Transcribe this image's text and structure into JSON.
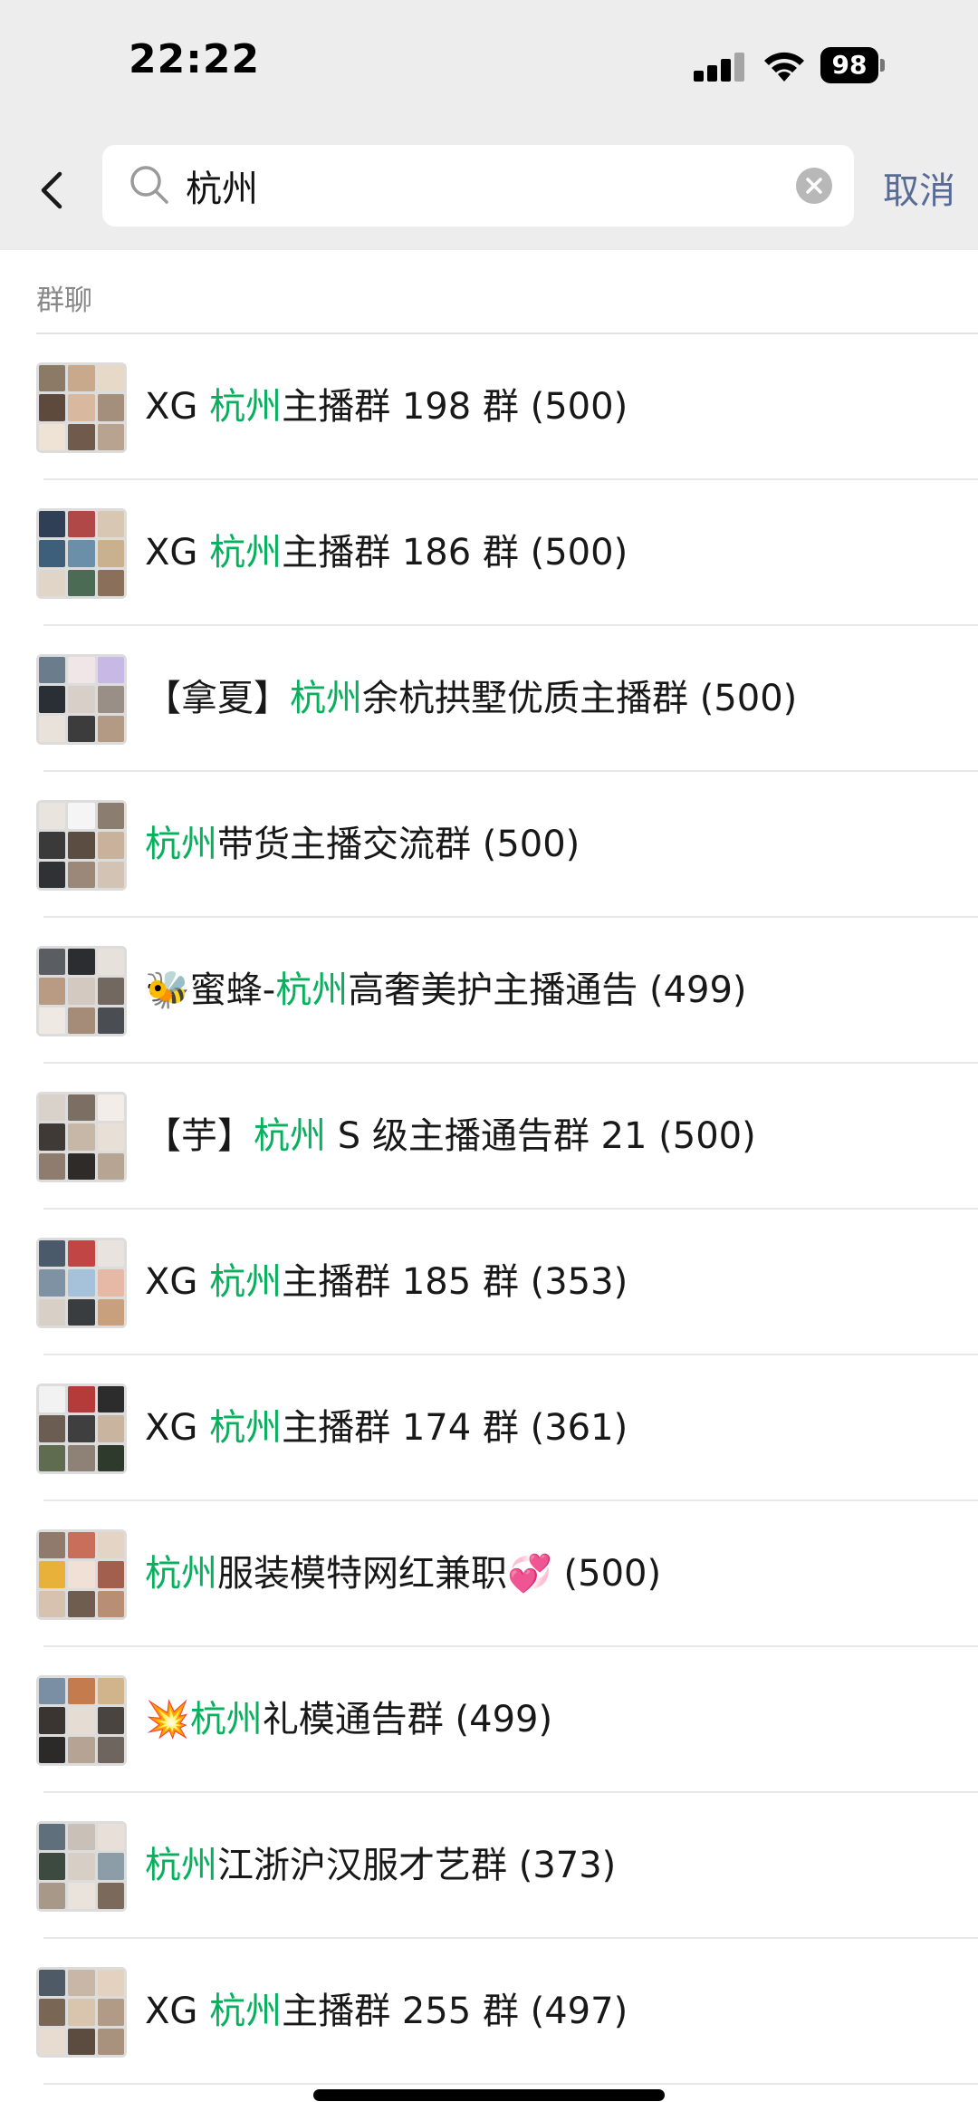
{
  "status_bar": {
    "time": "22:22",
    "battery_level": "98",
    "signal_icon": "cellular-signal-icon",
    "wifi_icon": "wifi-icon"
  },
  "search": {
    "query": "杭州",
    "placeholder": "",
    "cancel_label": "取消",
    "back_icon": "chevron-left-icon",
    "search_icon": "magnifier-icon",
    "clear_icon": "clear-circle-icon"
  },
  "section": {
    "title": "群聊"
  },
  "colors": {
    "keyword_highlight": "#07b05d",
    "link_blue": "#576b95",
    "header_background": "#ededed"
  },
  "results": [
    {
      "pre": "XG ",
      "kw": "杭州",
      "post": "主播群 198 群 (500)"
    },
    {
      "pre": "XG ",
      "kw": "杭州",
      "post": "主播群 186 群 (500)"
    },
    {
      "pre": "【拿夏】",
      "kw": "杭州",
      "post": "余杭拱墅优质主播群 (500)"
    },
    {
      "pre": "",
      "kw": "杭州",
      "post": "带货主播交流群 (500)"
    },
    {
      "pre": "🐝蜜蜂-",
      "kw": "杭州",
      "post": "高奢美护主播通告 (499)"
    },
    {
      "pre": "【芋】",
      "kw": "杭州",
      "post": " S 级主播通告群 21 (500)"
    },
    {
      "pre": "XG ",
      "kw": "杭州",
      "post": "主播群 185 群 (353)"
    },
    {
      "pre": "XG ",
      "kw": "杭州",
      "post": "主播群 174 群 (361)"
    },
    {
      "pre": "",
      "kw": "杭州",
      "post": "服装模特网红兼职💞 (500)"
    },
    {
      "pre": "💥",
      "kw": "杭州",
      "post": "礼模通告群 (499)"
    },
    {
      "pre": "",
      "kw": "杭州",
      "post": "江浙沪汉服才艺群 (373)"
    },
    {
      "pre": "XG ",
      "kw": "杭州",
      "post": "主播群 255 群 (497)"
    }
  ]
}
